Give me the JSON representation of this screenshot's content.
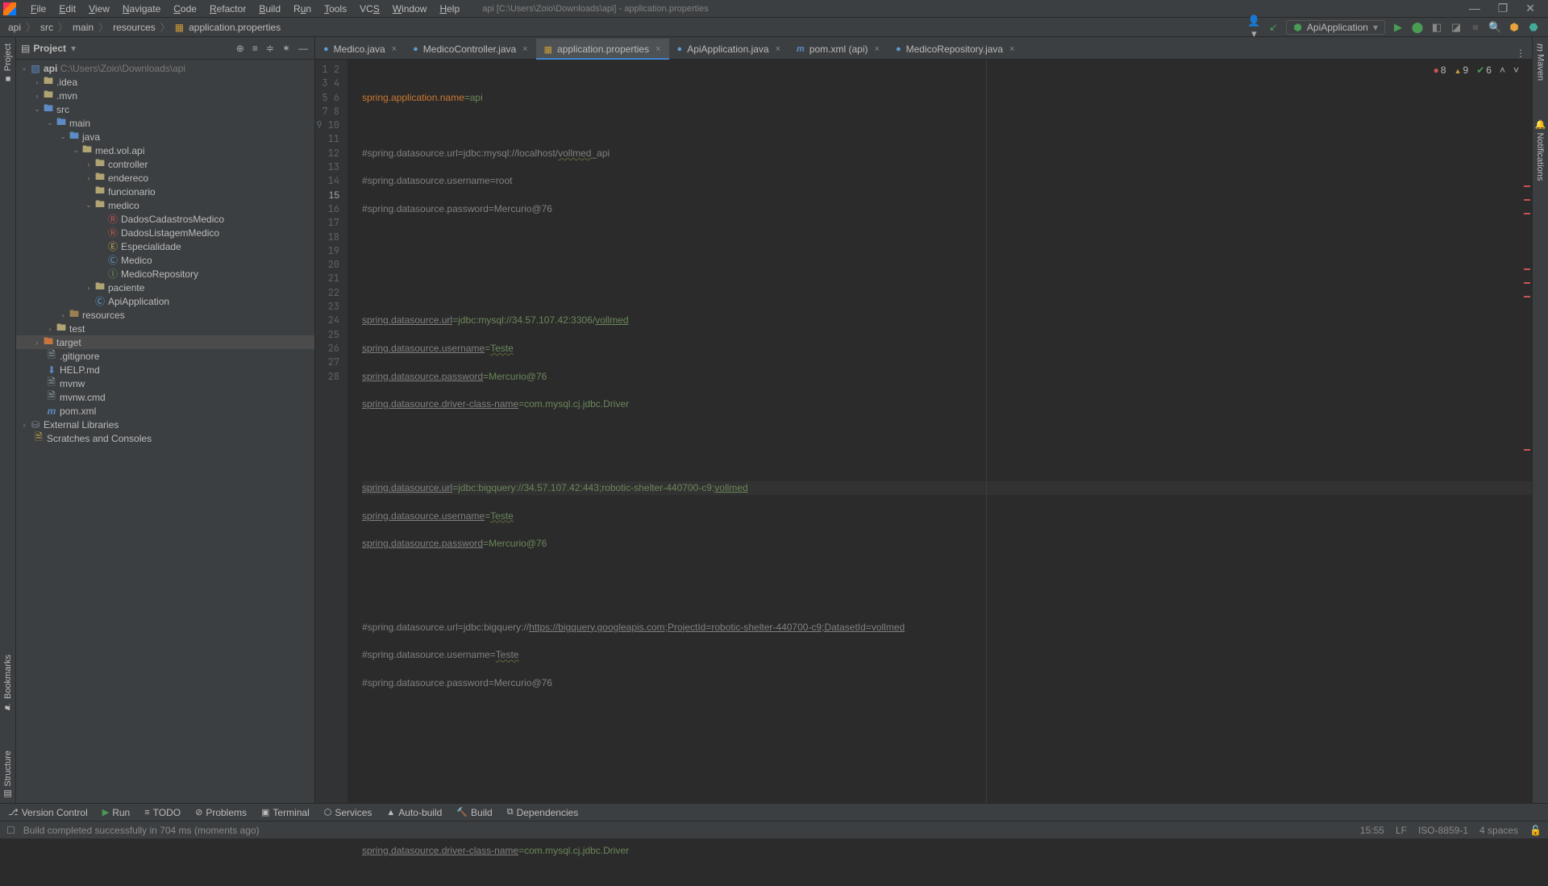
{
  "menu": [
    "File",
    "Edit",
    "View",
    "Navigate",
    "Code",
    "Refactor",
    "Build",
    "Run",
    "Tools",
    "VCS",
    "Window",
    "Help"
  ],
  "title": "api [C:\\Users\\Zoio\\Downloads\\api] - application.properties",
  "breadcrumbs": [
    "api",
    "src",
    "main",
    "resources",
    "application.properties"
  ],
  "run_config": "ApiApplication",
  "sidebar": {
    "label": "Project"
  },
  "tree": {
    "root": "api",
    "root_path": "C:\\Users\\Zoio\\Downloads\\api",
    "idea": ".idea",
    "mvn": ".mvn",
    "src": "src",
    "main": "main",
    "java": "java",
    "pkg": "med.vol.api",
    "controller": "controller",
    "endereco": "endereco",
    "funcionario": "funcionario",
    "medico": "medico",
    "dcm": "DadosCadastrosMedico",
    "dlm": "DadosListagemMedico",
    "esp": "Especialidade",
    "med": "Medico",
    "mrepo": "MedicoRepository",
    "paciente": "paciente",
    "apiapp": "ApiApplication",
    "resources": "resources",
    "test": "test",
    "target": "target",
    "gitignore": ".gitignore",
    "help": "HELP.md",
    "mvnw": "mvnw",
    "mvnwcmd": "mvnw.cmd",
    "pom": "pom.xml",
    "extlib": "External Libraries",
    "scratch": "Scratches and Consoles"
  },
  "tabs": [
    {
      "label": "Medico.java",
      "kind": "java"
    },
    {
      "label": "MedicoController.java",
      "kind": "java"
    },
    {
      "label": "application.properties",
      "kind": "props",
      "active": true
    },
    {
      "label": "ApiApplication.java",
      "kind": "java"
    },
    {
      "label": "pom.xml (api)",
      "kind": "m"
    },
    {
      "label": "MedicoRepository.java",
      "kind": "java"
    }
  ],
  "code": {
    "l1": "spring.application.name=api",
    "l3a": "#spring.datasource.url=jdbc:mysql://localhost/",
    "l3b": "vollmed",
    "l3c": "_api",
    "l4": "#spring.datasource.username=root",
    "l5": "#spring.datasource.password=Mercurio@76",
    "l9k": "spring.datasource.url",
    "l9v": "=jdbc:mysql://34.57.107.42:3306/",
    "l9u": "vollmed",
    "l10k": "spring.datasource.username",
    "l10v": "=",
    "l10u": "Teste",
    "l11k": "spring.datasource.password",
    "l11v": "=Mercurio@76",
    "l12k": "spring.datasource.driver-class-name",
    "l12v": "=com.mysql.cj.jdbc.Driver",
    "l15k": "spring.datasource.url",
    "l15v": "=jdbc:bigquery://34.57.107.42:443;robotic-shelter-440700-c9:",
    "l15u": "vollmed",
    "l16k": "spring.datasource.username",
    "l16v": "=",
    "l16u": "Teste",
    "l17k": "spring.datasource.password",
    "l17v": "=Mercurio@76",
    "l20a": "#spring.datasource.url=jdbc:bigquery://",
    "l20b": "https://bigquery.googleapis.com;ProjectId=robotic-shelter-440700-c9;DatasetId=vollmed",
    "l21a": "#spring.datasource.username=",
    "l21b": "Teste",
    "l22": "#spring.datasource.password=Mercurio@76",
    "l28k": "spring.datasource.driver-class-name",
    "l28v": "=com.mysql.cj.jdbc.Driver"
  },
  "inspection": {
    "errors": "8",
    "warnings": "9",
    "weak": "6"
  },
  "toolwindows": [
    "Version Control",
    "Run",
    "TODO",
    "Problems",
    "Terminal",
    "Services",
    "Auto-build",
    "Build",
    "Dependencies"
  ],
  "status": {
    "msg": "Build completed successfully in 704 ms (moments ago)",
    "pos": "15:55",
    "sep": "LF",
    "enc": "ISO-8859-1",
    "indent": "4 spaces"
  }
}
